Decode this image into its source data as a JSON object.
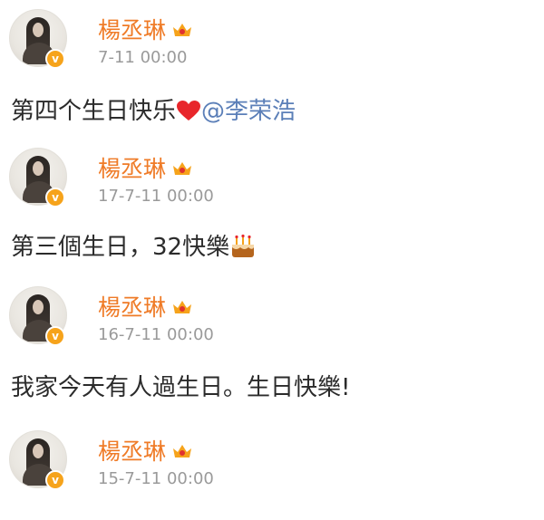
{
  "posts": [
    {
      "author": "楊丞琳",
      "time": "7-11 00:00",
      "text": "第四个生日快乐",
      "emoji": "heart-emoji",
      "mention": "@李荣浩"
    },
    {
      "author": "楊丞琳",
      "time": "17-7-11 00:00",
      "text": "第三個生日，32快樂",
      "emoji": "cake-emoji"
    },
    {
      "author": "楊丞琳",
      "time": "16-7-11 00:00",
      "text": "我家今天有人過生日。生日快樂!"
    },
    {
      "author": "楊丞琳",
      "time": "15-7-11 00:00"
    }
  ],
  "badge_letter": "v",
  "colors": {
    "name": "#ef7b27",
    "time": "#9a9a9a",
    "text": "#2b2b2b",
    "mention": "#5b7fb8",
    "badge": "#f6a31b"
  }
}
